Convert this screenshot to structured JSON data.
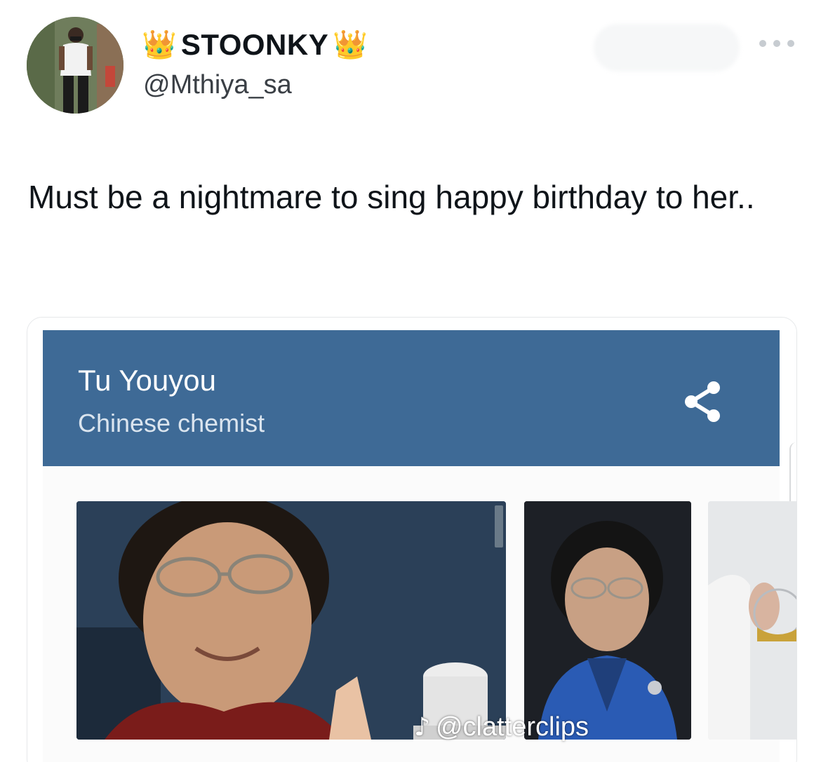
{
  "tweet": {
    "author": {
      "display_name": "STOONKY",
      "crown_emoji": "👑",
      "handle": "@Mthiya_sa",
      "avatar_icon": "user-avatar-photo"
    },
    "more_icon": "more-horizontal-icon",
    "text": "Must be a nightmare to sing happy birthday to her.."
  },
  "embedded_card": {
    "title": "Tu Youyou",
    "subtitle": "Chinese chemist",
    "share_icon": "share-icon",
    "header_color": "#3e6a96",
    "images": [
      {
        "name": "portrait-smiling"
      },
      {
        "name": "portrait-blue-jacket"
      },
      {
        "name": "lab-photo-partial"
      }
    ]
  },
  "watermark": {
    "icon": "tiktok-icon",
    "text": "@clatterclips"
  }
}
